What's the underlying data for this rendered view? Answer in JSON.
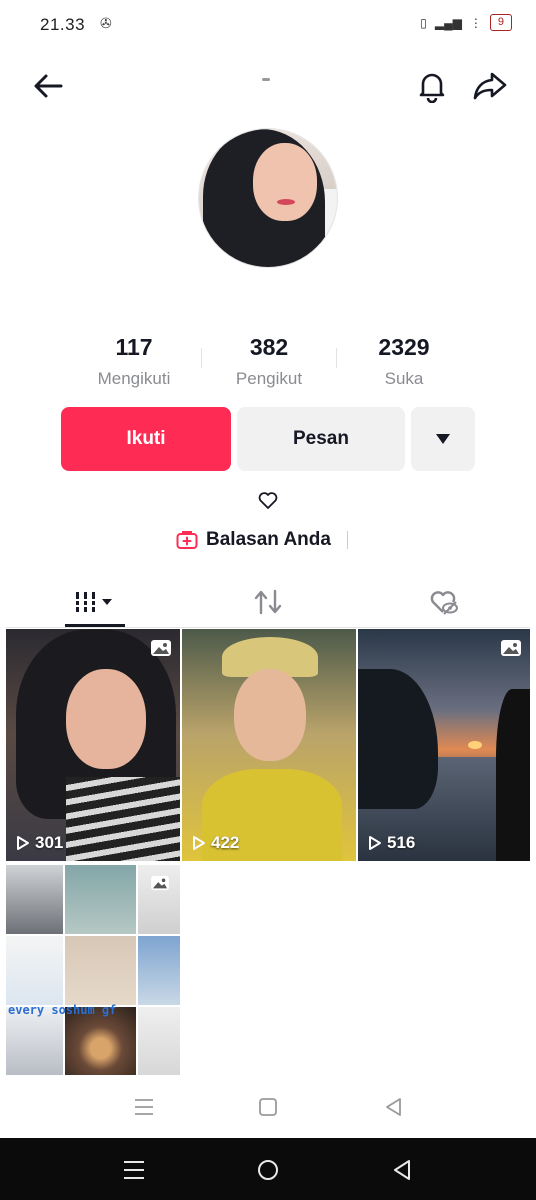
{
  "status_bar": {
    "time": "21.33",
    "extra_icon": "✇",
    "battery": "9"
  },
  "profile": {
    "stats": [
      {
        "value": "117",
        "label": "Mengikuti"
      },
      {
        "value": "382",
        "label": "Pengikut"
      },
      {
        "value": "2329",
        "label": "Suka"
      }
    ],
    "follow_label": "Ikuti",
    "message_label": "Pesan",
    "reply_label": "Balasan Anda"
  },
  "videos": [
    {
      "views": "301",
      "type": "photo"
    },
    {
      "views": "422",
      "type": "video"
    },
    {
      "views": "516",
      "type": "photo"
    }
  ],
  "collage": {
    "caption": "every soshum gf"
  },
  "colors": {
    "accent": "#fe2c55",
    "text": "#161823",
    "muted": "#8a8b91"
  }
}
